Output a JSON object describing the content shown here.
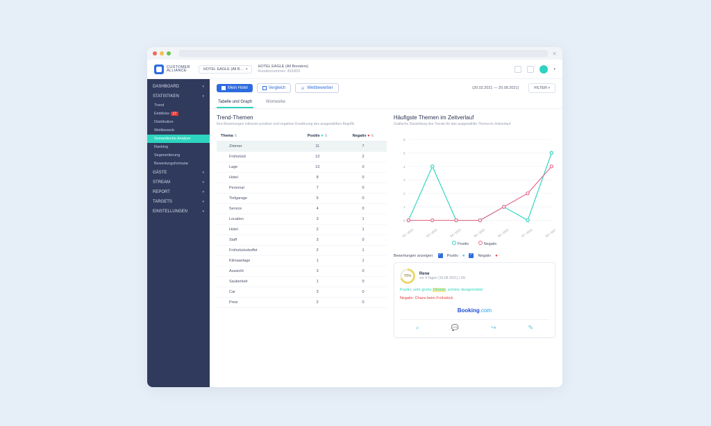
{
  "brand": {
    "line1": "CUSTOMER",
    "line2": "ALLIANCE"
  },
  "hotel_chip": "HOTEL EAGLE (All B…",
  "hotel_title": "HOTEL EAGLE (All Boosters)",
  "hotel_sub": "Kundennummer: 491803",
  "sidebar": [
    {
      "label": "DASHBOARD",
      "type": "main",
      "caret": false
    },
    {
      "label": "STATISTIKEN",
      "type": "main",
      "caret": true
    },
    {
      "label": "Trend",
      "type": "sub"
    },
    {
      "label": "Einblicke",
      "type": "sub",
      "badge": "17"
    },
    {
      "label": "Distribution",
      "type": "sub"
    },
    {
      "label": "Wettbewerb",
      "type": "sub"
    },
    {
      "label": "Semantische Analyse",
      "type": "sub",
      "active": true
    },
    {
      "label": "Ranking",
      "type": "sub"
    },
    {
      "label": "Segmentierung",
      "type": "sub"
    },
    {
      "label": "Bewertungsformular",
      "type": "sub"
    },
    {
      "label": "GÄSTE",
      "type": "main",
      "caret": true
    },
    {
      "label": "STREAM",
      "type": "main",
      "caret": true
    },
    {
      "label": "REPORT",
      "type": "main",
      "caret": true
    },
    {
      "label": "TARGETS",
      "type": "main",
      "caret": true
    },
    {
      "label": "EINSTELLUNGEN",
      "type": "main",
      "caret": true
    }
  ],
  "toolbar": {
    "mein": "Mein Hotel",
    "vergleich": "Vergleich",
    "wett": "Wettbewerber"
  },
  "daterange": "(20.02.2021 — 20.08.2021)",
  "filter_label": "FILTER",
  "tabs": {
    "a": "Tabelle und Graph",
    "b": "Wortwolke"
  },
  "trend": {
    "title": "Trend-Themen",
    "sub": "Ihre Bewertungen inklusive positiver und negativer Erwähnung des ausgewählten Begriffs",
    "cols": {
      "thema": "Thema",
      "pos": "Positiv",
      "neg": "Negativ"
    },
    "rows": [
      {
        "t": "Zimmer",
        "p": 11,
        "n": 7,
        "sel": true
      },
      {
        "t": "Frühstück",
        "p": 13,
        "n": 2
      },
      {
        "t": "Lage",
        "p": 13,
        "n": 0
      },
      {
        "t": "Hotel",
        "p": 8,
        "n": 0
      },
      {
        "t": "Personal",
        "p": 7,
        "n": 0
      },
      {
        "t": "Tiefgarage",
        "p": 5,
        "n": 0
      },
      {
        "t": "Service",
        "p": 4,
        "n": 0
      },
      {
        "t": "Location",
        "p": 3,
        "n": 1
      },
      {
        "t": "Hotel",
        "p": 2,
        "n": 1
      },
      {
        "t": "Staff",
        "p": 3,
        "n": 0
      },
      {
        "t": "Frühstücksbuffet",
        "p": 2,
        "n": 1
      },
      {
        "t": "Klimaanlage",
        "p": 1,
        "n": 1
      },
      {
        "t": "Aussicht",
        "p": 3,
        "n": 0
      },
      {
        "t": "Sauberkeit",
        "p": 1,
        "n": 0
      },
      {
        "t": "Car",
        "p": 3,
        "n": 0
      },
      {
        "t": "Preis",
        "p": 2,
        "n": 0
      }
    ]
  },
  "chart_data": {
    "type": "line",
    "title": "Häufigste Themen im Zeitverlauf",
    "sub": "Grafische Darstellung des Trends für das ausgewählte Thema im Zeitverlauf",
    "categories": [
      "02 / 2021",
      "03 / 2021",
      "04 / 2021",
      "05 / 2021",
      "06 / 2021",
      "07 / 2021",
      "08 / 2021"
    ],
    "series": [
      {
        "name": "Positiv",
        "color": "#2dd4bf",
        "values": [
          0,
          4,
          0,
          0,
          1,
          0,
          5
        ]
      },
      {
        "name": "Negativ",
        "color": "#e66a8a",
        "values": [
          0,
          0,
          0,
          0,
          1,
          2,
          4
        ]
      }
    ],
    "ylim": [
      0,
      6
    ]
  },
  "legend": {
    "pos": "Positiv",
    "neg": "Negativ"
  },
  "review_filter": {
    "label": "Bewertungen anzeigen:",
    "pos": "Positiv",
    "neg": "Negativ"
  },
  "review": {
    "score": "70%",
    "name": "Rene",
    "meta": "vor 4 Tagen (16.08.2021) | DE",
    "pos_label": "Positiv:",
    "pos_text_a": "sehr große ",
    "pos_hl": "Zimmer",
    "pos_text_b": ", schöne designmöbel",
    "neg_label": "Negativ:",
    "neg_text": "Chaos beim Frühstück",
    "source_a": "Booking",
    "source_b": ".com"
  }
}
